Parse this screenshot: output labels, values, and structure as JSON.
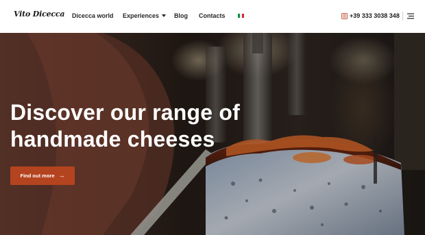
{
  "header": {
    "logo": "Vito Dicecca",
    "nav": [
      {
        "label": "Dicecca world"
      },
      {
        "label": "Experiences"
      },
      {
        "label": "Blog"
      },
      {
        "label": "Contacts"
      }
    ],
    "language_flag": "italy-flag-icon",
    "phone": "+39 333 3038 348",
    "phone_icon": "phone-icon",
    "menu_icon": "hamburger-menu-icon"
  },
  "hero": {
    "title_line1": "Discover our range of",
    "title_line2": "handmade cheeses",
    "cta_label": "Find out more",
    "cta_icon": "arrow-right-icon"
  },
  "colors": {
    "accent": "#b4441f",
    "flag_green": "#009246",
    "flag_white": "#ffffff",
    "flag_red": "#ce2b37",
    "phone_icon": "#c0533a"
  }
}
